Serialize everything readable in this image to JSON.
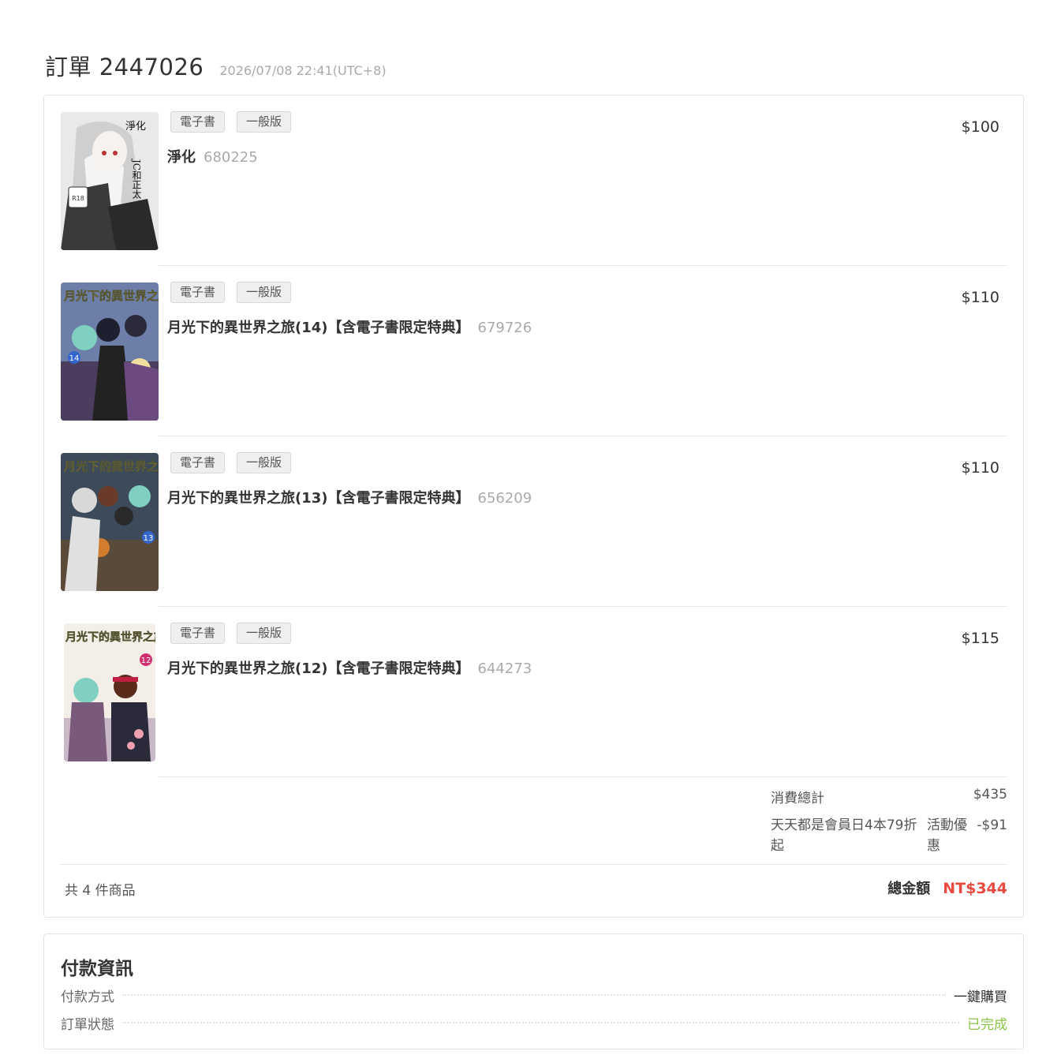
{
  "order": {
    "title": "訂單 2447026",
    "time": "2026/07/08 22:41(UTC+8)"
  },
  "items": [
    {
      "tags": [
        "電子書",
        "一般版"
      ],
      "name": "淨化",
      "product_id": "680225",
      "price": "$100",
      "cover_title": "淨化",
      "cover_subtitle": "JC和正太",
      "cover_rating": "R18"
    },
    {
      "tags": [
        "電子書",
        "一般版"
      ],
      "name": "月光下的異世界之旅(14)【含電子書限定特典】",
      "product_id": "679726",
      "price": "$110",
      "cover_title": "月光下的異世界之旅",
      "cover_volume": "14"
    },
    {
      "tags": [
        "電子書",
        "一般版"
      ],
      "name": "月光下的異世界之旅(13)【含電子書限定特典】",
      "product_id": "656209",
      "price": "$110",
      "cover_title": "月光下的異世界之旅",
      "cover_volume": "13"
    },
    {
      "tags": [
        "電子書",
        "一般版"
      ],
      "name": "月光下的異世界之旅(12)【含電子書限定特典】",
      "product_id": "644273",
      "price": "$115",
      "cover_title": "月光下的異世界之旅",
      "cover_volume": "12"
    }
  ],
  "summary": {
    "subtotal_label": "消費總計",
    "subtotal_value": "$435",
    "discount_name": "天天都是會員日4本79折起",
    "discount_type": "活動優惠",
    "discount_value": "-$91"
  },
  "footer": {
    "count_text": "共 4 件商品",
    "total_label": "總金額",
    "total_value": "NT$344"
  },
  "payment": {
    "title": "付款資訊",
    "method_label": "付款方式",
    "method_value": "一鍵購買",
    "status_label": "訂單狀態",
    "status_value": "已完成",
    "status_color": "#8bc34a"
  },
  "colors": {
    "total_accent": "#e84a3f"
  }
}
